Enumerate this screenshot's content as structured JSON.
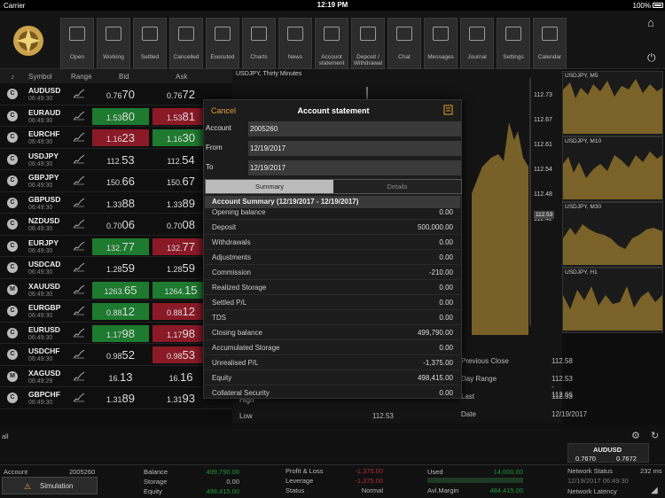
{
  "status": {
    "carrier": "Carrier",
    "time": "12:19 PM",
    "battery": "100%"
  },
  "toolbar": {
    "buttons": [
      {
        "label": "Open"
      },
      {
        "label": "Working"
      },
      {
        "label": "Settled"
      },
      {
        "label": "Cancelled"
      },
      {
        "label": "Executed"
      },
      {
        "label": "Charts"
      },
      {
        "label": "News"
      },
      {
        "label": "Account statement"
      },
      {
        "label": "Deposit / Withdrawal"
      },
      {
        "label": "Chat"
      },
      {
        "label": "Messages"
      },
      {
        "label": "Journal"
      },
      {
        "label": "Settings"
      },
      {
        "label": "Calendar"
      }
    ]
  },
  "quotes": {
    "headers": {
      "symbol": "Symbol",
      "range": "Range",
      "bid": "Bid",
      "ask": "Ask"
    },
    "rows": [
      {
        "badge": "C",
        "symbol": "AUDUSD",
        "time": "06:49:30",
        "bid_small": "0.76",
        "bid_big": "70",
        "ask_small": "0.76",
        "ask_big": "72",
        "bid_dir": "",
        "ask_dir": ""
      },
      {
        "badge": "C",
        "symbol": "EURAUD",
        "time": "06:49:30",
        "bid_small": "1.53",
        "bid_big": "80",
        "ask_small": "1.53",
        "ask_big": "81",
        "bid_dir": "up",
        "ask_dir": "dn"
      },
      {
        "badge": "C",
        "symbol": "EURCHF",
        "time": "06:49:30",
        "bid_small": "1.16",
        "bid_big": "23",
        "ask_small": "1.16",
        "ask_big": "30",
        "bid_dir": "dn",
        "ask_dir": "up"
      },
      {
        "badge": "C",
        "symbol": "USDJPY",
        "time": "06:49:30",
        "bid_small": "112.",
        "bid_big": "53",
        "ask_small": "112.",
        "ask_big": "54",
        "bid_dir": "",
        "ask_dir": ""
      },
      {
        "badge": "C",
        "symbol": "GBPJPY",
        "time": "06:49:30",
        "bid_small": "150.",
        "bid_big": "66",
        "ask_small": "150.",
        "ask_big": "67",
        "bid_dir": "",
        "ask_dir": ""
      },
      {
        "badge": "C",
        "symbol": "GBPUSD",
        "time": "06:49:30",
        "bid_small": "1.33",
        "bid_big": "88",
        "ask_small": "1.33",
        "ask_big": "89",
        "bid_dir": "",
        "ask_dir": ""
      },
      {
        "badge": "C",
        "symbol": "NZDUSD",
        "time": "06:49:30",
        "bid_small": "0.70",
        "bid_big": "06",
        "ask_small": "0.70",
        "ask_big": "08",
        "bid_dir": "",
        "ask_dir": ""
      },
      {
        "badge": "C",
        "symbol": "EURJPY",
        "time": "06:49:30",
        "bid_small": "132.",
        "bid_big": "77",
        "ask_small": "132.",
        "ask_big": "77",
        "bid_dir": "up",
        "ask_dir": "dn"
      },
      {
        "badge": "C",
        "symbol": "USDCAD",
        "time": "06:49:30",
        "bid_small": "1.28",
        "bid_big": "59",
        "ask_small": "1.28",
        "ask_big": "59",
        "bid_dir": "",
        "ask_dir": ""
      },
      {
        "badge": "M",
        "symbol": "XAUUSD",
        "time": "06:49:30",
        "bid_small": "1263.",
        "bid_big": "65",
        "ask_small": "1264.",
        "ask_big": "15",
        "bid_dir": "up",
        "ask_dir": "up"
      },
      {
        "badge": "C",
        "symbol": "EURGBP",
        "time": "06:49:30",
        "bid_small": "0.88",
        "bid_big": "12",
        "ask_small": "0.88",
        "ask_big": "12",
        "bid_dir": "up",
        "ask_dir": "dn"
      },
      {
        "badge": "C",
        "symbol": "EURUSD",
        "time": "06:49:30",
        "bid_small": "1.17",
        "bid_big": "98",
        "ask_small": "1.17",
        "ask_big": "98",
        "bid_dir": "up",
        "ask_dir": "dn"
      },
      {
        "badge": "C",
        "symbol": "USDCHF",
        "time": "06:49:30",
        "bid_small": "0.98",
        "bid_big": "52",
        "ask_small": "0.98",
        "ask_big": "53",
        "bid_dir": "",
        "ask_dir": "dn"
      },
      {
        "badge": "M",
        "symbol": "XAGUSD",
        "time": "06:49:29",
        "bid_small": "16.",
        "bid_big": "13",
        "ask_small": "16.",
        "ask_big": "16",
        "bid_dir": "",
        "ask_dir": ""
      },
      {
        "badge": "C",
        "symbol": "GBPCHF",
        "time": "06:49:30",
        "bid_small": "1.31",
        "bid_big": "89",
        "ask_small": "1.31",
        "ask_big": "93",
        "bid_dir": "",
        "ask_dir": ""
      }
    ]
  },
  "chart": {
    "title": "USDJPY, Thirty Minutes",
    "price_labels": [
      "112.73",
      "112.67",
      "112.61",
      "112.54",
      "112.48",
      "112.42"
    ],
    "current": "112.53"
  },
  "minis": [
    {
      "title": "USDJPY, M5"
    },
    {
      "title": "USDJPY, M10"
    },
    {
      "title": "USDJPY, M30"
    },
    {
      "title": "USDJPY, H1"
    }
  ],
  "info": {
    "rows": [
      {
        "k": "Previous Close",
        "v": "112.58"
      },
      {
        "k": "Day Range",
        "v": "112.53 - 112.66"
      },
      {
        "k": "Last",
        "v": "112.53"
      },
      {
        "k": "Date",
        "v": "12/19/2017"
      }
    ],
    "low_label": "Low",
    "low_value": "112.53",
    "high_label": "High"
  },
  "modal": {
    "cancel": "Cancel",
    "title": "Account statement",
    "account_label": "Account",
    "account_value": "2005260",
    "from_label": "From",
    "from_value": "12/19/2017",
    "to_label": "To",
    "to_value": "12/19/2017",
    "tab_summary": "Summary",
    "tab_details": "Details",
    "section_title": "Account Summary (12/19/2017 - 12/19/2017)",
    "rows": [
      {
        "k": "Opening balance",
        "v": "0.00"
      },
      {
        "k": "Deposit",
        "v": "500,000.00"
      },
      {
        "k": "Withdrawals",
        "v": "0.00"
      },
      {
        "k": "Adjustments",
        "v": "0.00"
      },
      {
        "k": "Commission",
        "v": "-210.00"
      },
      {
        "k": "Realized Storage",
        "v": "0.00"
      },
      {
        "k": "Settled P/L",
        "v": "0.00"
      },
      {
        "k": "TDS",
        "v": "0.00"
      },
      {
        "k": "Closing balance",
        "v": "499,790.00"
      },
      {
        "k": "Accumulated Storage",
        "v": "0.00"
      },
      {
        "k": "Unrealised P/L",
        "v": "-1,375.00"
      },
      {
        "k": "Equity",
        "v": "498,415.00"
      },
      {
        "k": "Collateral Security",
        "v": "0.00"
      }
    ]
  },
  "footer": {
    "filter": "all",
    "account_label": "Account",
    "account_value": "2005260",
    "mode": "Simulation",
    "balance_label": "Balance",
    "balance_value": "499,790.00",
    "storage_label": "Storage",
    "storage_value": "0.00",
    "equity_label": "Equity",
    "equity_value": "498,415.00",
    "pl_label": "Profit & Loss",
    "pl_value": "-1,375.00",
    "leverage_label": "Leverage",
    "leverage_value": "-1,375.00",
    "status_label": "Status",
    "status_value": "Normal",
    "used_label": "Used",
    "used_value": "14,000.00",
    "avl_label": "Avl.Margin",
    "avl_value": "484,415.00",
    "ticker_symbol": "AUDUSD",
    "ticker_bid": "0.7670",
    "ticker_ask": "0.7672",
    "ticker_time": "12/19/2017 06:49:30",
    "net_status_label": "Network Status",
    "net_status_value": "232 ms",
    "net_latency_label": "Network Latency"
  }
}
